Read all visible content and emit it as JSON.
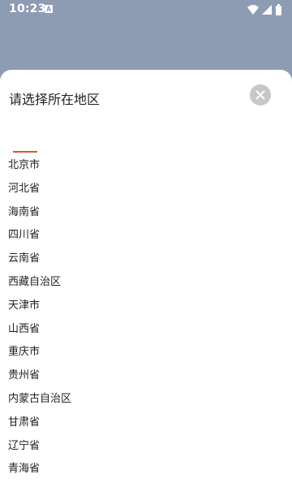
{
  "status_bar": {
    "time": "10:23",
    "icons": [
      "notification-a-icon",
      "wifi-icon",
      "cellular-icon",
      "battery-icon"
    ]
  },
  "sheet": {
    "title": "请选择所在地区",
    "close_icon": "close-icon"
  },
  "regions": [
    "北京市",
    "河北省",
    "海南省",
    "四川省",
    "云南省",
    "西藏自治区",
    "天津市",
    "山西省",
    "重庆市",
    "贵州省",
    "内蒙古自治区",
    "甘肃省",
    "辽宁省",
    "青海省"
  ],
  "colors": {
    "backdrop": "#8d9bb3",
    "accent": "#e0523f",
    "close_button": "#c7c7c7"
  }
}
